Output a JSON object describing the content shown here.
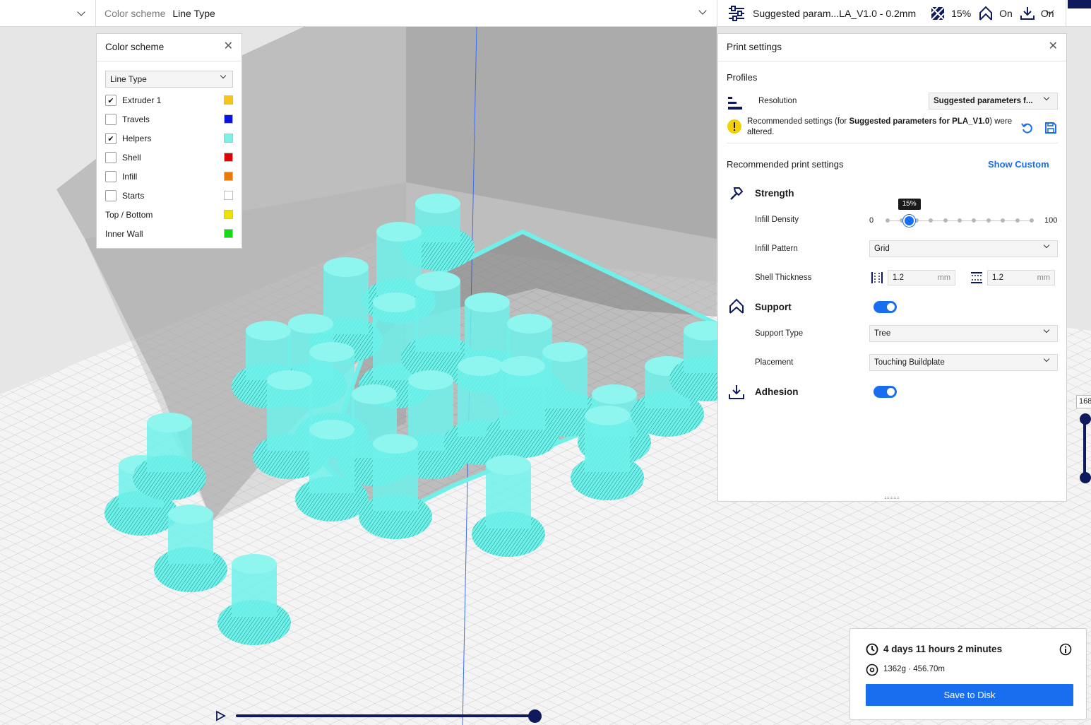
{
  "topbar": {
    "color_scheme_label": "Color scheme",
    "color_scheme_value": "Line Type",
    "profile_label": "Suggested param...LA_V1.0 - 0.2mm",
    "infill_value": "15%",
    "support_value": "On",
    "adhesion_value": "On"
  },
  "color_scheme_panel": {
    "title": "Color scheme",
    "select_value": "Line Type",
    "items": [
      {
        "label": "Extruder 1",
        "checked": true,
        "color": "#f5c518"
      },
      {
        "label": "Travels",
        "checked": false,
        "color": "#0a14e0"
      },
      {
        "label": "Helpers",
        "checked": true,
        "color": "#7ff0e6"
      },
      {
        "label": "Shell",
        "checked": false,
        "color": "#e00000"
      },
      {
        "label": "Infill",
        "checked": false,
        "color": "#e87a0a"
      },
      {
        "label": "Starts",
        "checked": false,
        "color": "#ffffff"
      },
      {
        "label": "Top / Bottom",
        "color": "#f0e000"
      },
      {
        "label": "Inner Wall",
        "color": "#11dd11"
      }
    ],
    "check_glyph": "✔"
  },
  "print_settings": {
    "title": "Print settings",
    "profiles_label": "Profiles",
    "resolution_label": "Resolution",
    "resolution_value": "Suggested parameters f...",
    "notice_prefix": "Recommended settings (for ",
    "notice_bold": "Suggested parameters for PLA_V1.0",
    "notice_suffix": ") were altered.",
    "recommended_label": "Recommended print settings",
    "show_custom": "Show Custom",
    "strength_label": "Strength",
    "infill_density_label": "Infill Density",
    "infill_min": "0",
    "infill_max": "100",
    "infill_value": "15%",
    "infill_fraction": 0.15,
    "infill_pattern_label": "Infill Pattern",
    "infill_pattern_value": "Grid",
    "shell_thickness_label": "Shell Thickness",
    "wall_thickness": "1.2",
    "top_bottom_thickness": "1.2",
    "unit": "mm",
    "support_label": "Support",
    "support_enabled": true,
    "support_type_label": "Support Type",
    "support_type_value": "Tree",
    "placement_label": "Placement",
    "placement_value": "Touching Buildplate",
    "adhesion_label": "Adhesion",
    "adhesion_enabled": true,
    "accent_color": "#196ef0"
  },
  "estimate": {
    "time": "4 days 11 hours 2 minutes",
    "material": "1362g · 456.70m",
    "save_button": "Save to Disk"
  },
  "layer_view": {
    "layer_number": "168",
    "layer_fraction": 1.0
  },
  "viewport": {
    "model_color": "#6ff1ea",
    "volume_color": "#9a9a9a"
  }
}
